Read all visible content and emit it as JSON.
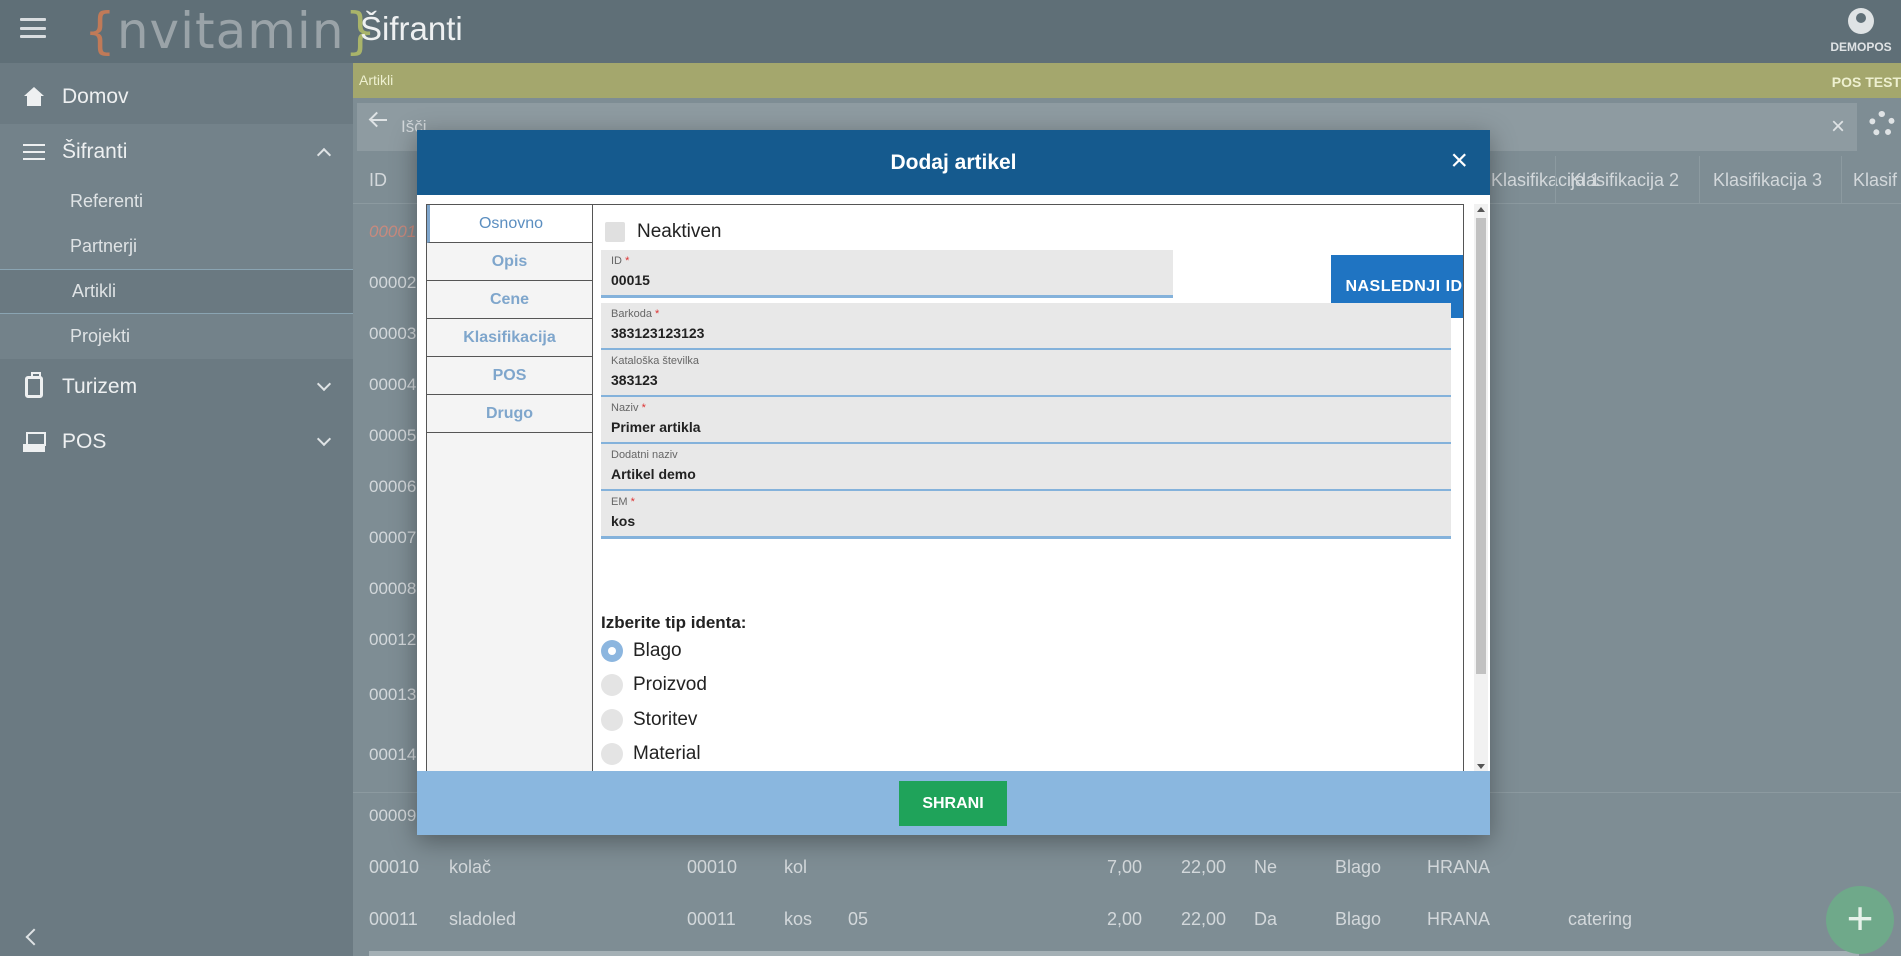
{
  "header": {
    "logo_left_bracket": "{",
    "logo_text": "nvitamin",
    "logo_right_bracket": "}",
    "page_title": "Šifranti",
    "user_name": "DEMOPOS"
  },
  "sidebar": {
    "items": [
      {
        "label": "Domov",
        "icon": "home-icon"
      },
      {
        "label": "Šifranti",
        "icon": "list-icon",
        "expanded": true,
        "children": [
          "Referenti",
          "Partnerji",
          "Artikli",
          "Projekti"
        ]
      },
      {
        "label": "Turizem",
        "icon": "luggage-icon"
      },
      {
        "label": "POS",
        "icon": "pos-icon"
      }
    ]
  },
  "content": {
    "breadcrumb": "Artikli",
    "env_label": "POS TEST",
    "search_placeholder": "Išči",
    "columns": [
      "ID",
      "Klasifikacija 1",
      "Klasifikacija 2",
      "Klasifikacija 3",
      "Klasif"
    ],
    "row_ids": [
      "00001",
      "00002",
      "00003",
      "00004",
      "00005",
      "00006",
      "00007",
      "00008",
      "00012",
      "00013",
      "00014",
      "00009"
    ],
    "rows": [
      {
        "id": "00010",
        "name": "kolač",
        "code": "00010",
        "unit": "kol",
        "extra": "",
        "price": "7,00",
        "vat": "22,00",
        "flag": "Ne",
        "type": "Blago",
        "group": "HRANA",
        "klas2": ""
      },
      {
        "id": "00011",
        "name": "sladoled",
        "code": "00011",
        "unit": "kos",
        "extra": "05",
        "price": "2,00",
        "vat": "22,00",
        "flag": "Da",
        "type": "Blago",
        "group": "HRANA",
        "klas2": "catering"
      }
    ],
    "fab_label": "+"
  },
  "modal": {
    "title": "Dodaj artikel",
    "close_label": "×",
    "tabs": [
      "Osnovno",
      "Opis",
      "Cene",
      "Klasifikacija",
      "POS",
      "Drugo"
    ],
    "inactive_label": "Neaktiven",
    "next_id_button": "NASLEDNJI ID",
    "fields": [
      {
        "label": "ID",
        "required": true,
        "value": "00015"
      },
      {
        "label": "Barkoda",
        "required": true,
        "value": "383123123123"
      },
      {
        "label": "Kataloška številka",
        "required": false,
        "value": "383123"
      },
      {
        "label": "Naziv",
        "required": true,
        "value": "Primer artikla"
      },
      {
        "label": "Dodatni naziv",
        "required": false,
        "value": "Artikel demo"
      },
      {
        "label": "EM",
        "required": true,
        "value": "kos"
      }
    ],
    "required_mark": "*",
    "ident_type_title": "Izberite tip identa:",
    "ident_types": [
      "Blago",
      "Proizvod",
      "Storitev",
      "Material"
    ],
    "selected_ident_type": "Blago",
    "save_button": "SHRANI"
  },
  "colors": {
    "modal_header": "#155a8e",
    "next_button": "#1f74c2",
    "save_button": "#1fa35a",
    "footer": "#8ab7df"
  }
}
